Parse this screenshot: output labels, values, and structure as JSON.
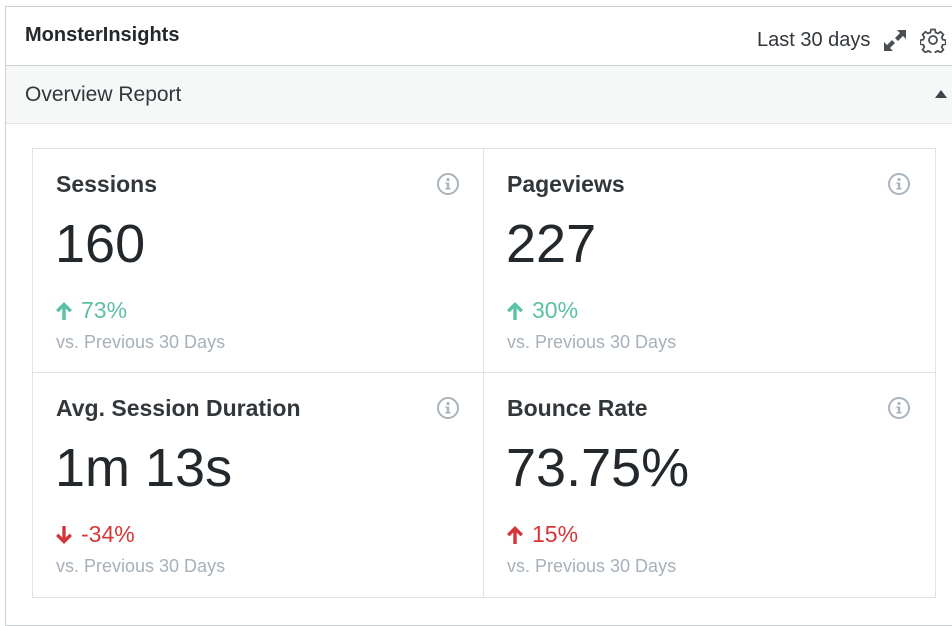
{
  "header": {
    "title": "MonsterInsights",
    "period": "Last 30 days"
  },
  "report": {
    "title": "Overview Report"
  },
  "tiles": [
    {
      "label": "Sessions",
      "value": "160",
      "change": "73%",
      "trend": "up",
      "compare": "vs. Previous 30 Days"
    },
    {
      "label": "Pageviews",
      "value": "227",
      "change": "30%",
      "trend": "up",
      "compare": "vs. Previous 30 Days"
    },
    {
      "label": "Avg. Session Duration",
      "value": "1m 13s",
      "change": "-34%",
      "trend": "down",
      "compare": "vs. Previous 30 Days"
    },
    {
      "label": "Bounce Rate",
      "value": "73.75%",
      "change": "15%",
      "trend": "up-bad",
      "compare": "vs. Previous 30 Days"
    }
  ],
  "colors": {
    "positive": "#5cc0a5",
    "negative": "#d73638",
    "info_icon": "#a8b3bd"
  },
  "icons": {
    "expand": "expand-icon",
    "settings": "gear-icon",
    "info": "info-icon",
    "collapse": "caret-up-icon"
  }
}
